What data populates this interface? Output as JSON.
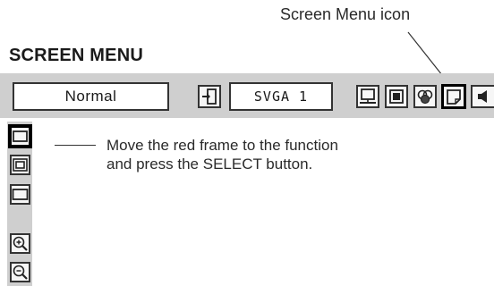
{
  "callout": {
    "label": "Screen Menu icon"
  },
  "heading": "SCREEN MENU",
  "menubar": {
    "mode_label": "Normal",
    "source_label": "SVGA 1",
    "icons": [
      "input-icon",
      "normal-screen-icon",
      "true-screen-icon",
      "image-icon",
      "screen-menu-icon",
      "sound-icon"
    ]
  },
  "side_menu": {
    "items": [
      "normal-mode-icon",
      "true-mode-icon",
      "wide-mode-icon",
      "zoom-in-icon",
      "zoom-out-icon"
    ]
  },
  "instruction": {
    "line1": "Move the red frame to the function",
    "line2": "and press the SELECT button."
  }
}
